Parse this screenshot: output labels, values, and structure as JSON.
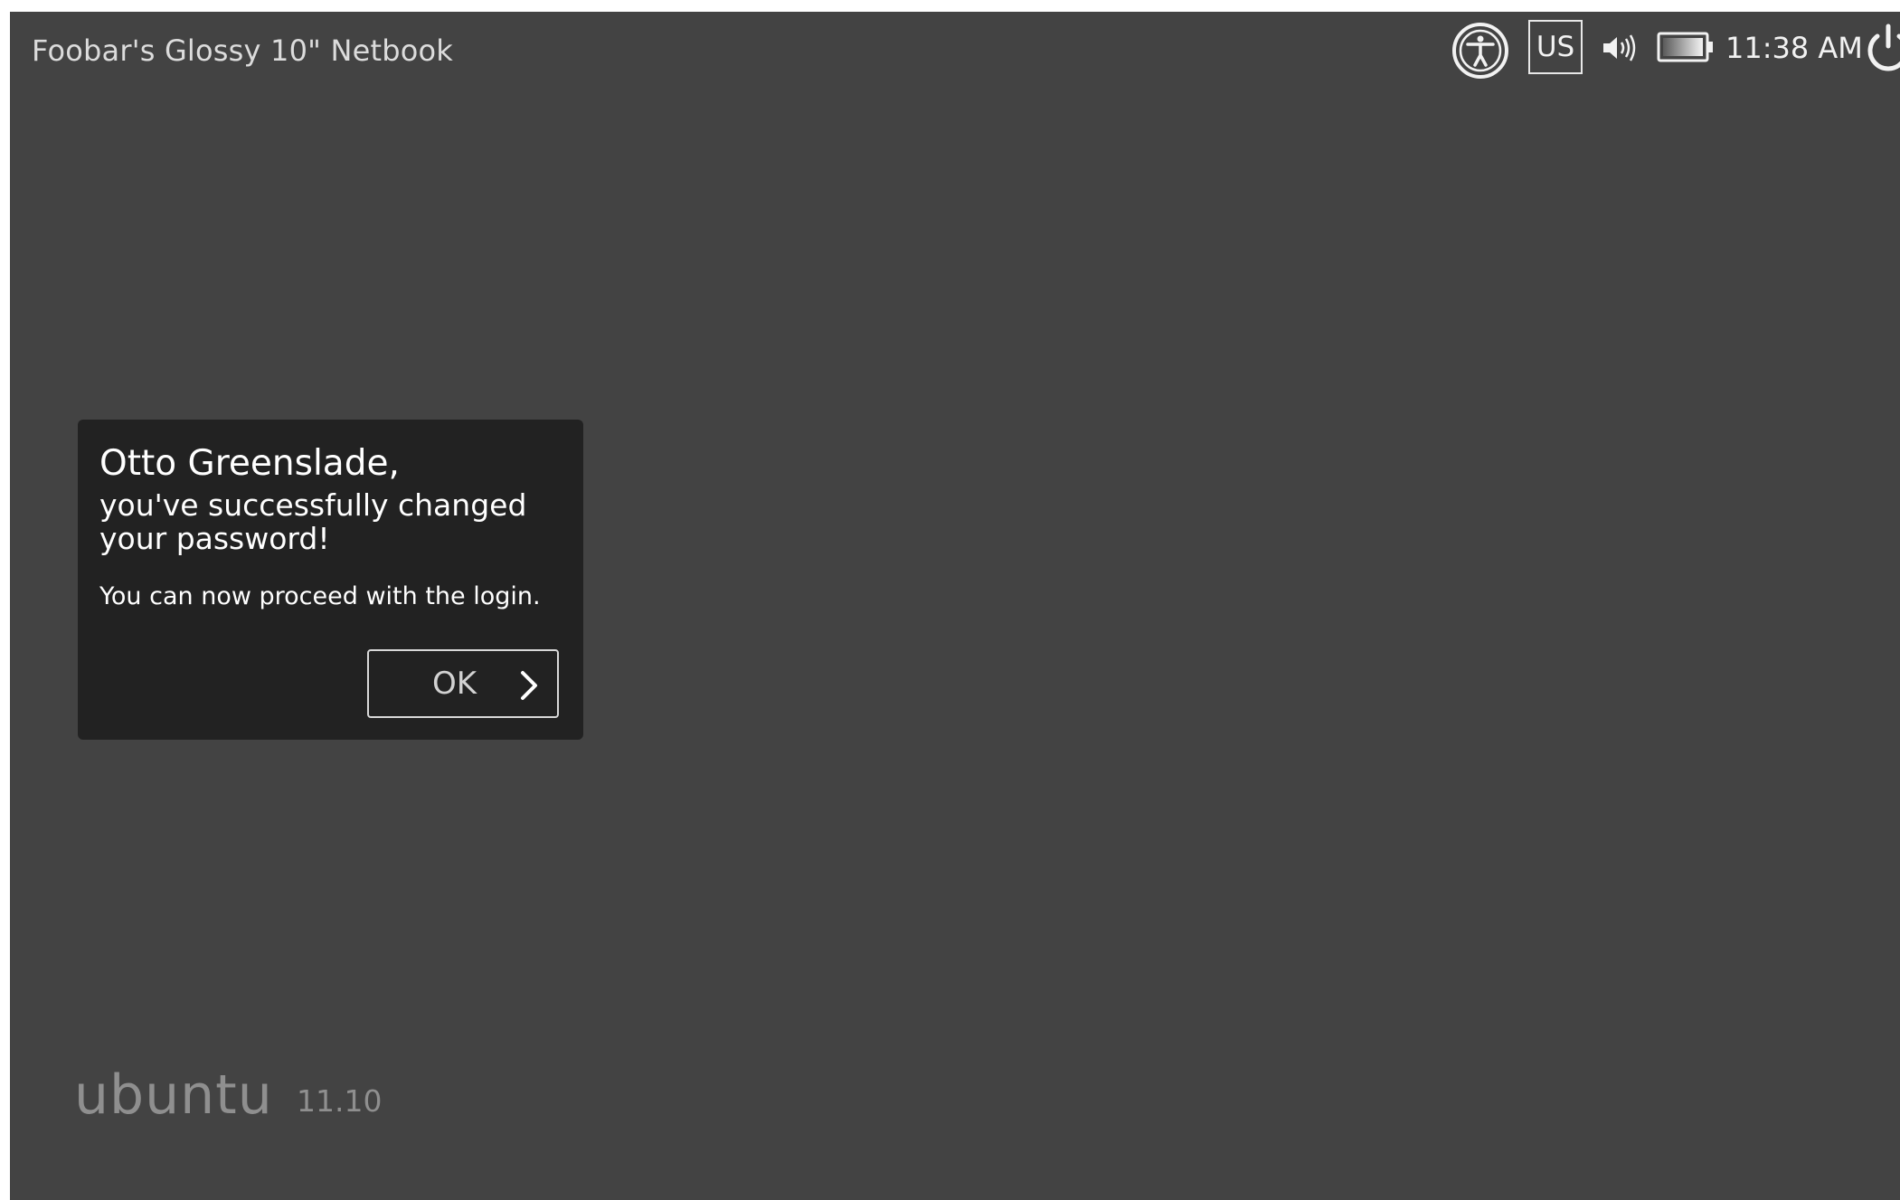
{
  "panel": {
    "host_name": "Foobar's Glossy 10\" Netbook",
    "keyboard_layout": "US",
    "clock": "11:38 AM",
    "icons": [
      "accessibility-icon",
      "volume-icon",
      "battery-icon",
      "power-icon"
    ]
  },
  "dialog": {
    "title": "Otto Greenslade,",
    "subtitle": "you've successfully changed your password!",
    "message": "You can now proceed with the login.",
    "ok_label": "OK",
    "ok_icon": "chevron-right-icon"
  },
  "branding": {
    "logo_text": "ubuntu",
    "version": "11.10"
  },
  "colors": {
    "background": "#434343",
    "dialog": "#222222",
    "text": "#ffffff",
    "muted": "#8f8f8f"
  }
}
